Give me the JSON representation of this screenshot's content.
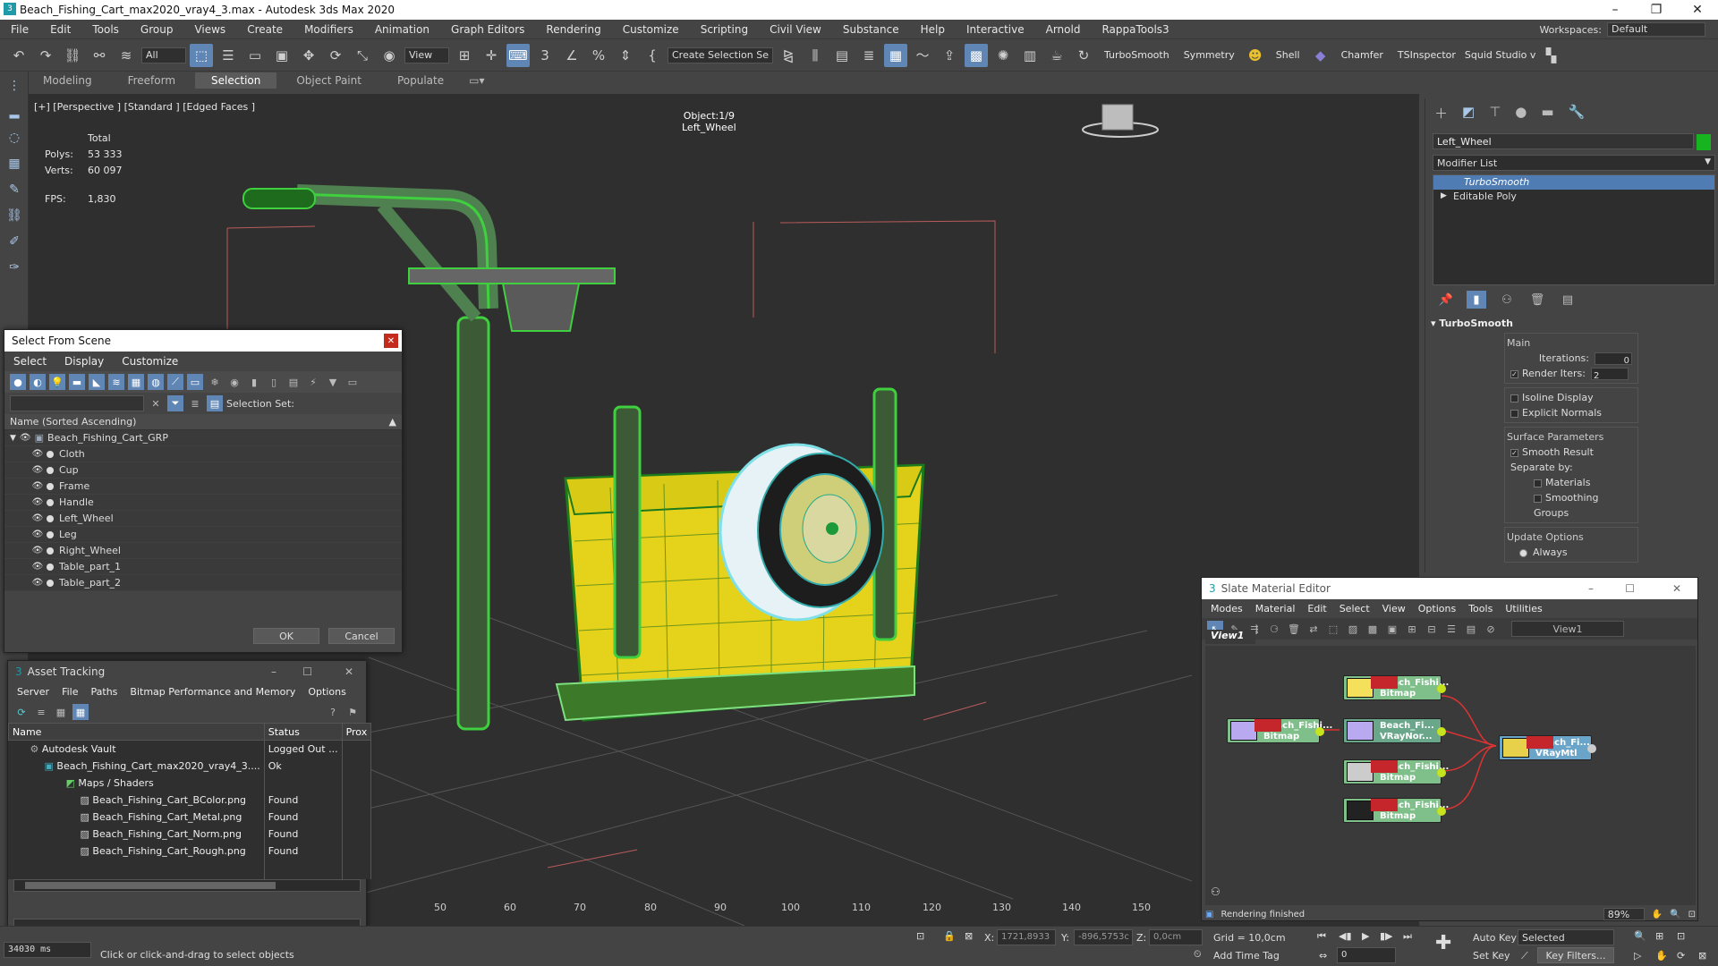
{
  "window": {
    "title": "Beach_Fishing_Cart_max2020_vray4_3.max - Autodesk 3ds Max 2020",
    "min": "–",
    "max": "❐",
    "close": "✕"
  },
  "menu": [
    "File",
    "Edit",
    "Tools",
    "Group",
    "Views",
    "Create",
    "Modifiers",
    "Animation",
    "Graph Editors",
    "Rendering",
    "Customize",
    "Scripting",
    "Civil View",
    "Substance",
    "Help",
    "Interactive",
    "Arnold",
    "RappaTools3"
  ],
  "workspace": {
    "label": "Workspaces:",
    "value": "Default"
  },
  "toolbar": {
    "filter": "All",
    "view": "View",
    "selset": "Create Selection Se",
    "turbosmooth": "TurboSmooth",
    "symmetry": "Symmetry",
    "shell": "Shell",
    "chamfer": "Chamfer",
    "tsinspector": "TSInspector",
    "squid": "Squid Studio v"
  },
  "ribbon": [
    "Modeling",
    "Freeform",
    "Selection",
    "Object Paint",
    "Populate"
  ],
  "viewport": {
    "label": "[+] [Perspective ] [Standard ] [Edged Faces ]",
    "stats_header": "Total",
    "polys_label": "Polys:",
    "polys": "53 333",
    "verts_label": "Verts:",
    "verts": "60 097",
    "fps_label": "FPS:",
    "fps": "1,830",
    "object_count": "Object:1/9",
    "object_name": "Left_Wheel"
  },
  "cmd": {
    "object": "Left_Wheel",
    "color": "#17b41f",
    "modlist": "Modifier List",
    "stack": [
      "TurboSmooth",
      "Editable Poly"
    ],
    "rollout": "TurboSmooth",
    "main": "Main",
    "iter_label": "Iterations:",
    "iter": "0",
    "render_label": "Render Iters:",
    "render": "2",
    "isoline": "Isoline Display",
    "explicit": "Explicit Normals",
    "surface": "Surface Parameters",
    "smooth": "Smooth Result",
    "separate": "Separate by:",
    "materials": "Materials",
    "smoothing": "Smoothing Groups",
    "update": "Update Options",
    "always": "Always"
  },
  "sfs": {
    "title": "Select From Scene",
    "menu": [
      "Select",
      "Display",
      "Customize"
    ],
    "selset": "Selection Set:",
    "header": "Name (Sorted Ascending)",
    "root": "Beach_Fishing_Cart_GRP",
    "items": [
      "Cloth",
      "Cup",
      "Frame",
      "Handle",
      "Left_Wheel",
      "Leg",
      "Right_Wheel",
      "Table_part_1",
      "Table_part_2"
    ],
    "ok": "OK",
    "cancel": "Cancel"
  },
  "at": {
    "title": "Asset Tracking",
    "menu": [
      "Server",
      "File",
      "Paths",
      "Bitmap Performance and Memory",
      "Options"
    ],
    "cols": [
      "Name",
      "Status",
      "Prox"
    ],
    "rows": [
      {
        "name": "Autodesk Vault",
        "status": "Logged Out ..."
      },
      {
        "name": "Beach_Fishing_Cart_max2020_vray4_3....",
        "status": "Ok"
      },
      {
        "name": "Maps / Shaders",
        "status": ""
      },
      {
        "name": "Beach_Fishing_Cart_BColor.png",
        "status": "Found"
      },
      {
        "name": "Beach_Fishing_Cart_Metal.png",
        "status": "Found"
      },
      {
        "name": "Beach_Fishing_Cart_Norm.png",
        "status": "Found"
      },
      {
        "name": "Beach_Fishing_Cart_Rough.png",
        "status": "Found"
      }
    ]
  },
  "sme": {
    "title": "Slate Material Editor",
    "menu": [
      "Modes",
      "Material",
      "Edit",
      "Select",
      "View",
      "Options",
      "Tools",
      "Utilities"
    ],
    "view": "View1",
    "tab": "View1",
    "status": "Rendering finished",
    "zoom": "89%",
    "nodes": {
      "n1a": "Beach_Fishi...",
      "n1b": "Bitmap",
      "n2a": "Beach_Fi...",
      "n2b": "VRayNor...",
      "n3a": "Beach_Fishi...",
      "n3b": "Bitmap",
      "n4a": "Beach_Fishi...",
      "n4b": "Bitmap",
      "n5a": "Beach_Fishi...",
      "n5b": "Bitmap",
      "n6a": "Beach_Fi...",
      "n6b": "VRayMtl"
    }
  },
  "timeline": [
    "50",
    "60",
    "70",
    "80",
    "90",
    "100",
    "110",
    "120",
    "130",
    "140",
    "150"
  ],
  "status": {
    "time": "34030 ms",
    "prompt": "Click or click-and-drag to select objects",
    "x_label": "X:",
    "x": "1721,8933",
    "y_label": "Y:",
    "y": "-896,5753c",
    "z_label": "Z:",
    "z": "0,0cm",
    "grid": "Grid = 10,0cm",
    "addtag": "Add Time Tag",
    "autokey": "Auto Key",
    "selected": "Selected",
    "setkey": "Set Key",
    "keyfilters": "Key Filters...",
    "frame": "0"
  }
}
